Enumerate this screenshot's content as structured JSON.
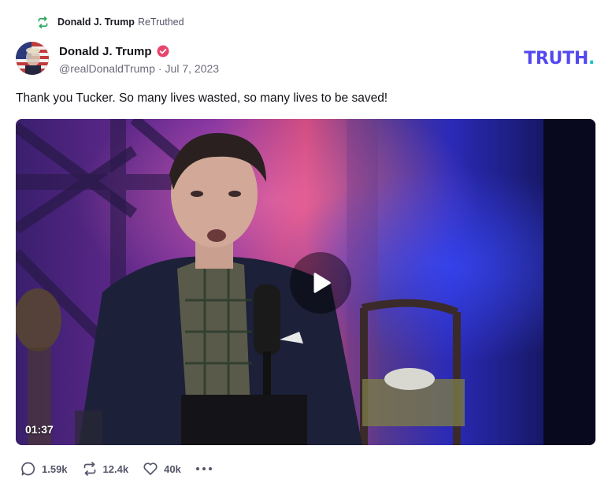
{
  "retruth": {
    "icon": "retruth-icon",
    "name": "Donald J. Trump",
    "suffix": "ReTruthed",
    "accent": "#27a65a"
  },
  "author": {
    "display_name": "Donald J. Trump",
    "verified_icon": "verified-badge-icon",
    "verified_color": "#e8456b",
    "handle": "@realDonaldTrump",
    "separator": "·",
    "date": "Jul 7, 2023"
  },
  "brand": {
    "wordmark": "TRUTH",
    "dot": ".",
    "color": "#5448ee",
    "dot_color": "#19c4b8"
  },
  "post": {
    "text": "Thank you Tucker. So many lives wasted, so many lives to be saved!"
  },
  "video": {
    "play_icon": "play-icon",
    "duration": "01:37"
  },
  "actions": {
    "replies": {
      "icon": "reply-icon",
      "count": "1.59k"
    },
    "retruths": {
      "icon": "retruth-icon",
      "count": "12.4k"
    },
    "likes": {
      "icon": "heart-icon",
      "count": "40k"
    },
    "more": {
      "icon": "more-options-icon"
    }
  }
}
